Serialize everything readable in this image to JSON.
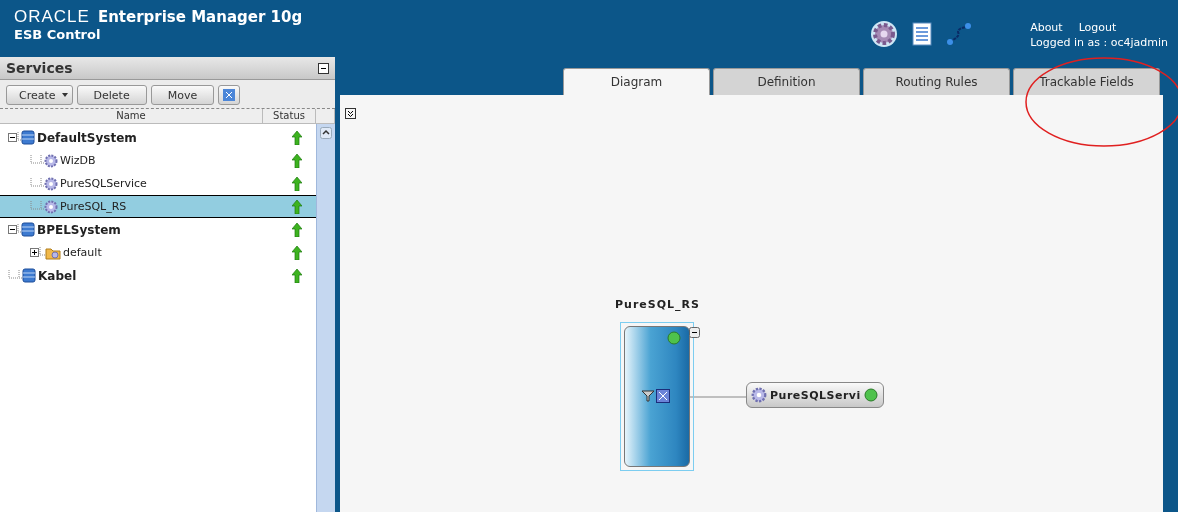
{
  "header": {
    "brand": "ORACLE",
    "product": "Enterprise Manager 10g",
    "subtitle": "ESB Control",
    "links": [
      "About",
      "Logout"
    ],
    "login_text": "Logged in as : oc4jadmin"
  },
  "services_panel": {
    "title": "Services",
    "toolbar": [
      "Create",
      "Delete",
      "Move"
    ],
    "columns": [
      "Name",
      "Status"
    ],
    "tree": [
      {
        "label": "DefaultSystem",
        "kind": "system",
        "expanded": true,
        "selected": false,
        "children": [
          {
            "label": "WizDB",
            "kind": "service",
            "selected": false
          },
          {
            "label": "PureSQLService",
            "kind": "service",
            "selected": false
          },
          {
            "label": "PureSQL_RS",
            "kind": "service",
            "selected": true
          }
        ]
      },
      {
        "label": "BPELSystem",
        "kind": "system",
        "expanded": true,
        "selected": false,
        "children": [
          {
            "label": "default",
            "kind": "group",
            "expanded": false,
            "selected": false
          }
        ]
      },
      {
        "label": "Kabel",
        "kind": "system",
        "selected": false
      }
    ]
  },
  "tabs": [
    {
      "label": "Diagram",
      "selected": true
    },
    {
      "label": "Definition",
      "selected": false
    },
    {
      "label": "Routing Rules",
      "selected": false
    },
    {
      "label": "Trackable Fields",
      "selected": false
    }
  ],
  "diagram": {
    "router": {
      "label": "PureSQL_RS"
    },
    "target": {
      "label": "PureSQLServi"
    }
  }
}
